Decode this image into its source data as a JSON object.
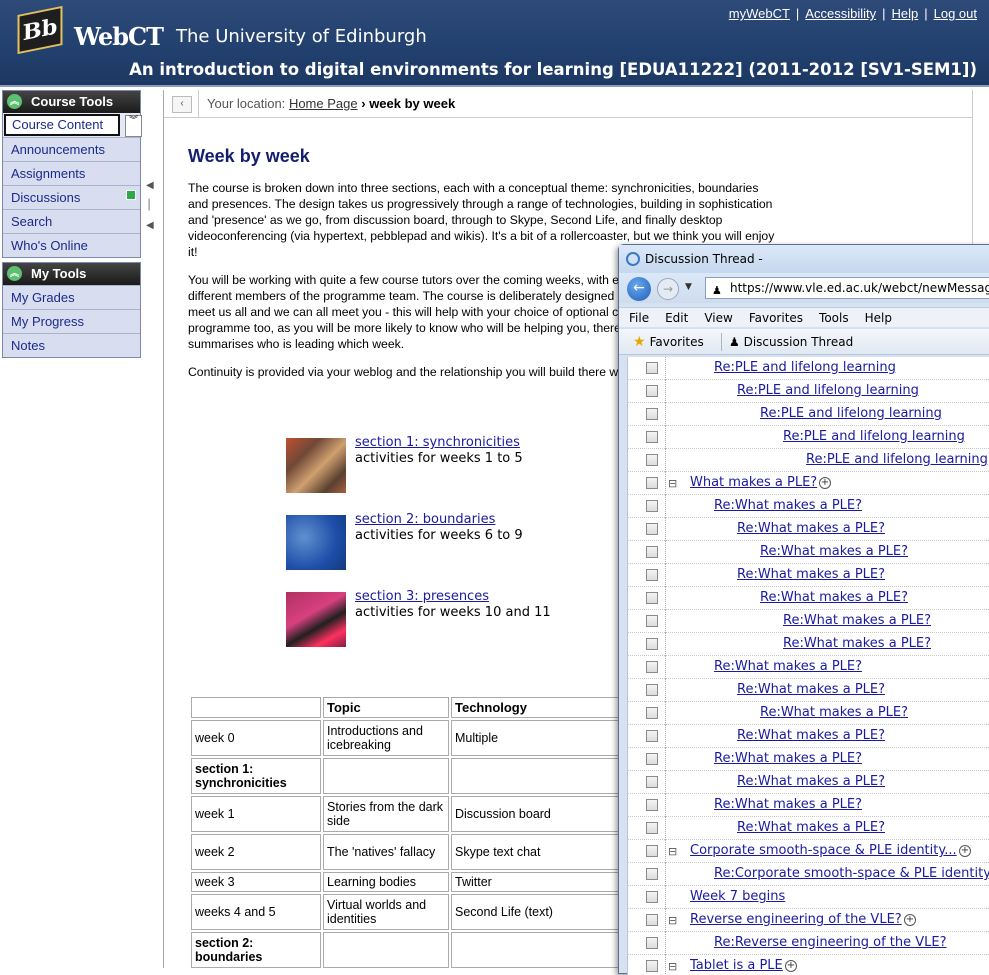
{
  "header": {
    "logo_text": "Bb",
    "webct": "WebCT",
    "university": "The University of Edinburgh",
    "course_title": "An introduction to digital environments for learning [EDUA11222] (2011-2012 [SV1-SEM1])",
    "links": [
      "myWebCT",
      "Accessibility",
      "Help",
      "Log out"
    ]
  },
  "sidebar": {
    "course_tools": {
      "title": "Course Tools",
      "items": [
        "Course Content",
        "Announcements",
        "Assignments",
        "Discussions",
        "Search",
        "Who's Online"
      ]
    },
    "my_tools": {
      "title": "My Tools",
      "items": [
        "My Grades",
        "My Progress",
        "Notes"
      ]
    }
  },
  "location": {
    "label": "Your location:",
    "home": "Home Page",
    "separator": "›",
    "current": "week by week"
  },
  "main": {
    "title": "Week by week",
    "para1": "The course is broken down into three sections, each with a conceptual theme: synchronicities, boundaries and presences. The design takes us progressively through a range of technologies, building in sophistication and 'presence' as we go, from discussion board, through to Skype, Second Life, and finally desktop videoconferencing (via hypertext, pebblepad and wikis). It's a bit of a rollercoaster, but we think you will enjoy it!",
    "para2": "You will be working with quite a few course tutors over the coming weeks, with each section being led by different members of the programme team. The course is deliberately designed in this way so that you can meet us all and we can all meet you - this will help with your choice of optional courses later in the programme too, as you will be more likely to know who will be helping you, there's a table below which summarises who is leading which week.",
    "para3": "Continuity is provided via your weblog and the relationship you will build there with your personal tutor.",
    "sections": [
      {
        "link": "section 1: synchronicities",
        "sub": "activities for weeks 1 to 5"
      },
      {
        "link": "section 2: boundaries",
        "sub": "activities for weeks 6 to 9"
      },
      {
        "link": "section 3: presences",
        "sub": "activities for weeks 10 and 11"
      }
    ],
    "table": {
      "headers": [
        "",
        "Topic",
        "Technology"
      ],
      "rows": [
        [
          "week 0",
          "Introductions and icebreaking",
          "Multiple"
        ],
        [
          "section 1: synchronicities",
          "",
          ""
        ],
        [
          "week 1",
          "Stories from the dark side",
          "Discussion board"
        ],
        [
          "week 2",
          "The 'natives' fallacy",
          "Skype text chat"
        ],
        [
          "week 3",
          "Learning bodies",
          "Twitter"
        ],
        [
          "weeks 4 and 5",
          "Virtual worlds and identities",
          "Second Life (text)"
        ],
        [
          "section 2: boundaries",
          "",
          ""
        ]
      ]
    }
  },
  "popup": {
    "title": "Discussion Thread -",
    "url": "https://www.vle.ed.ac.uk/webct/newMessageTh",
    "menu": [
      "File",
      "Edit",
      "View",
      "Favorites",
      "Tools",
      "Help"
    ],
    "favorites": "Favorites",
    "tab": "Discussion Thread",
    "threads": [
      {
        "text": "Re:PLE and lifelong learning",
        "indent": 2,
        "toggle": false,
        "plus": false
      },
      {
        "text": "Re:PLE and lifelong learning",
        "indent": 3,
        "toggle": false,
        "plus": false
      },
      {
        "text": "Re:PLE and lifelong learning",
        "indent": 4,
        "toggle": false,
        "plus": false
      },
      {
        "text": "Re:PLE and lifelong learning",
        "indent": 5,
        "toggle": false,
        "plus": false
      },
      {
        "text": "Re:PLE and lifelong learning",
        "indent": 6,
        "toggle": false,
        "plus": false
      },
      {
        "text": "What makes a PLE?",
        "indent": 1,
        "toggle": true,
        "plus": true
      },
      {
        "text": "Re:What makes a PLE?",
        "indent": 2,
        "toggle": false,
        "plus": false
      },
      {
        "text": "Re:What makes a PLE?",
        "indent": 3,
        "toggle": false,
        "plus": false
      },
      {
        "text": "Re:What makes a PLE?",
        "indent": 4,
        "toggle": false,
        "plus": false
      },
      {
        "text": "Re:What makes a PLE?",
        "indent": 3,
        "toggle": false,
        "plus": false
      },
      {
        "text": "Re:What makes a PLE?",
        "indent": 4,
        "toggle": false,
        "plus": false
      },
      {
        "text": "Re:What makes a PLE?",
        "indent": 5,
        "toggle": false,
        "plus": false
      },
      {
        "text": "Re:What makes a PLE?",
        "indent": 5,
        "toggle": false,
        "plus": false
      },
      {
        "text": "Re:What makes a PLE?",
        "indent": 2,
        "toggle": false,
        "plus": false
      },
      {
        "text": "Re:What makes a PLE?",
        "indent": 3,
        "toggle": false,
        "plus": false
      },
      {
        "text": "Re:What makes a PLE?",
        "indent": 4,
        "toggle": false,
        "plus": false
      },
      {
        "text": "Re:What makes a PLE?",
        "indent": 3,
        "toggle": false,
        "plus": false
      },
      {
        "text": "Re:What makes a PLE?",
        "indent": 2,
        "toggle": false,
        "plus": false
      },
      {
        "text": "Re:What makes a PLE?",
        "indent": 3,
        "toggle": false,
        "plus": false
      },
      {
        "text": "Re:What makes a PLE?",
        "indent": 2,
        "toggle": false,
        "plus": false
      },
      {
        "text": "Re:What makes a PLE?",
        "indent": 3,
        "toggle": false,
        "plus": false
      },
      {
        "text": "Corporate smooth-space & PLE identity...",
        "indent": 1,
        "toggle": true,
        "plus": true
      },
      {
        "text": "Re:Corporate smooth-space & PLE identity",
        "indent": 2,
        "toggle": false,
        "plus": false
      },
      {
        "text": "Week 7 begins",
        "indent": 1,
        "toggle": false,
        "plus": false
      },
      {
        "text": "Reverse engineering of the VLE?",
        "indent": 1,
        "toggle": true,
        "plus": true
      },
      {
        "text": "Re:Reverse engineering of the VLE?",
        "indent": 2,
        "toggle": false,
        "plus": false
      },
      {
        "text": "Tablet is a PLE",
        "indent": 1,
        "toggle": true,
        "plus": true
      }
    ]
  },
  "colors": {
    "header_bg": "#22406e",
    "link": "#1a1aa0",
    "title": "#141e6e",
    "sidebar_bg": "#d8def0"
  }
}
